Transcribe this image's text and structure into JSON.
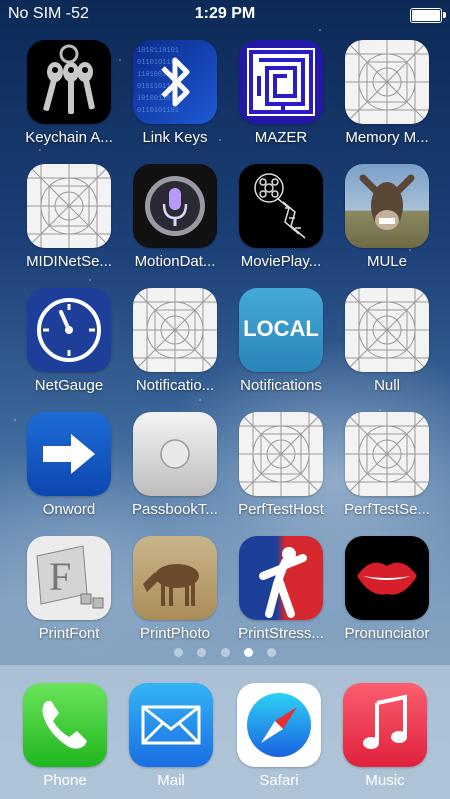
{
  "status_bar": {
    "carrier": "No SIM  -52",
    "time": "1:29 PM"
  },
  "apps": [
    {
      "label": "Keychain A...",
      "icon": "keys-icon"
    },
    {
      "label": "Link Keys",
      "icon": "bluetooth-icon"
    },
    {
      "label": "MAZER",
      "icon": "maze-icon"
    },
    {
      "label": "Memory M...",
      "icon": "placeholder-icon"
    },
    {
      "label": "MIDINetSe...",
      "icon": "placeholder-icon"
    },
    {
      "label": "MotionDat...",
      "icon": "siri-microphone-icon"
    },
    {
      "label": "MoviePlay...",
      "icon": "film-reel-icon"
    },
    {
      "label": "MULe",
      "icon": "mule-photo-icon"
    },
    {
      "label": "NetGauge",
      "icon": "gauge-icon"
    },
    {
      "label": "Notificatio...",
      "icon": "placeholder-icon"
    },
    {
      "label": "Notifications",
      "icon": "local-icon",
      "icon_text": "LOCAL"
    },
    {
      "label": "Null",
      "icon": "placeholder-icon"
    },
    {
      "label": "Onword",
      "icon": "arrow-right-icon"
    },
    {
      "label": "PassbookT...",
      "icon": "button-icon"
    },
    {
      "label": "PerfTestHost",
      "icon": "placeholder-icon"
    },
    {
      "label": "PerfTestSe...",
      "icon": "placeholder-icon"
    },
    {
      "label": "PrintFont",
      "icon": "font-icon"
    },
    {
      "label": "PrintPhoto",
      "icon": "horse-photo-icon"
    },
    {
      "label": "PrintStress...",
      "icon": "athlete-icon"
    },
    {
      "label": "Pronunciator",
      "icon": "lips-icon"
    }
  ],
  "page_indicator": {
    "count": 5,
    "active": 4
  },
  "dock": [
    {
      "label": "Phone",
      "icon": "phone-icon"
    },
    {
      "label": "Mail",
      "icon": "mail-icon"
    },
    {
      "label": "Safari",
      "icon": "compass-icon"
    },
    {
      "label": "Music",
      "icon": "music-note-icon"
    }
  ]
}
